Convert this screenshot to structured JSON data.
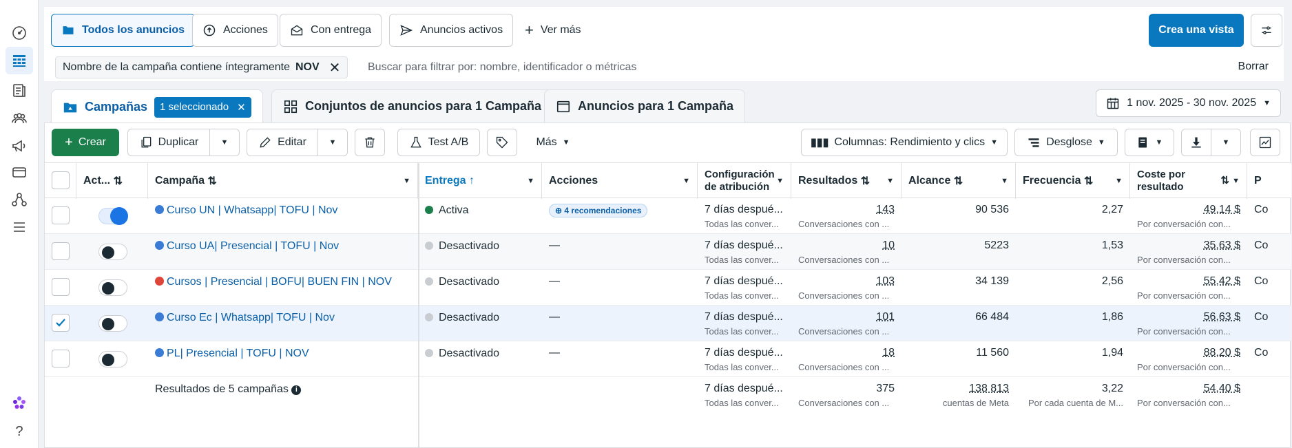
{
  "top_tabs": [
    {
      "label": "Todos los anuncios",
      "icon": "folder-icon"
    },
    {
      "label": "Acciones",
      "icon": "upload-circle-icon"
    },
    {
      "label": "Con entrega",
      "icon": "envelope-icon"
    },
    {
      "label": "Anuncios activos",
      "icon": "send-icon"
    }
  ],
  "more_views": "Ver más",
  "create_view": "Crea una vista",
  "filter": {
    "chip_label": "Nombre de la campaña contiene íntegramente",
    "chip_value": "NOV",
    "placeholder": "Buscar para filtrar por: nombre, identificador o métricas",
    "clear": "Borrar"
  },
  "level_tabs": {
    "campaigns": "Campañas",
    "selected": "1 seleccionado",
    "adsets": "Conjuntos de anuncios para 1 Campaña",
    "ads": "Anuncios para 1 Campaña"
  },
  "date_range": "1 nov. 2025 - 30 nov. 2025",
  "toolbar": {
    "create": "Crear",
    "duplicate": "Duplicar",
    "edit": "Editar",
    "ab_test": "Test A/B",
    "more": "Más",
    "columns": "Columnas: Rendimiento y clics",
    "breakdown": "Desglose"
  },
  "headers": {
    "active": "Act...",
    "campaign": "Campaña",
    "delivery": "Entrega",
    "actions": "Acciones",
    "attribution_1": "Configuración",
    "attribution_2": "de atribución",
    "results": "Resultados",
    "reach": "Alcance",
    "frequency": "Frecuencia",
    "cost_1": "Coste por",
    "cost_2": "resultado",
    "next": "P"
  },
  "rows": [
    {
      "name": "Curso UN | Whatsapp| TOFU | Nov",
      "dot": "#3a7bd5",
      "on": true,
      "checked": false,
      "delivery": "Activa",
      "delivery_color": "#1a7f4b",
      "actions": "4 recomendaciones",
      "attr": "7 días despué...",
      "attr_sub": "Todas las conver...",
      "results": "143",
      "results_sub": "Conversaciones con ...",
      "reach": "90 536",
      "freq": "2,27",
      "cost": "49,14 $",
      "cost_sub": "Por conversación con...",
      "next": "Co"
    },
    {
      "name": "Curso UA| Presencial | TOFU | Nov",
      "dot": "#3a7bd5",
      "on": false,
      "checked": false,
      "delivery": "Desactivado",
      "delivery_color": "#c9ccd1",
      "actions": "—",
      "attr": "7 días despué...",
      "attr_sub": "Todas las conver...",
      "results": "10",
      "results_sub": "Conversaciones con ...",
      "reach": "5223",
      "freq": "1,53",
      "cost": "35,63 $",
      "cost_sub": "Por conversación con...",
      "next": "Co"
    },
    {
      "name": "Cursos | Presencial | BOFU| BUEN FIN | NOV",
      "dot": "#e0453a",
      "on": false,
      "checked": false,
      "delivery": "Desactivado",
      "delivery_color": "#c9ccd1",
      "actions": "—",
      "attr": "7 días despué...",
      "attr_sub": "Todas las conver...",
      "results": "103",
      "results_sub": "Conversaciones con ...",
      "reach": "34 139",
      "freq": "2,56",
      "cost": "55,42 $",
      "cost_sub": "Por conversación con...",
      "next": "Co"
    },
    {
      "name": "Curso Ec | Whatsapp| TOFU | Nov",
      "dot": "#3a7bd5",
      "on": false,
      "checked": true,
      "delivery": "Desactivado",
      "delivery_color": "#c9ccd1",
      "actions": "—",
      "attr": "7 días despué...",
      "attr_sub": "Todas las conver...",
      "results": "101",
      "results_sub": "Conversaciones con ...",
      "reach": "66 484",
      "freq": "1,86",
      "cost": "56,63 $",
      "cost_sub": "Por conversación con...",
      "next": "Co"
    },
    {
      "name": "PL| Presencial | TOFU | NOV",
      "dot": "#3a7bd5",
      "on": false,
      "checked": false,
      "delivery": "Desactivado",
      "delivery_color": "#c9ccd1",
      "actions": "—",
      "attr": "7 días despué...",
      "attr_sub": "Todas las conver...",
      "results": "18",
      "results_sub": "Conversaciones con ...",
      "reach": "11 560",
      "freq": "1,94",
      "cost": "88,20 $",
      "cost_sub": "Por conversación con...",
      "next": "Co"
    }
  ],
  "totals": {
    "label": "Resultados de 5 campañas",
    "attr": "7 días despué...",
    "attr_sub": "Todas las conver...",
    "results": "375",
    "results_sub": "Conversaciones con ...",
    "reach": "138 813",
    "reach_sub": "cuentas de Meta",
    "freq": "3,22",
    "freq_sub": "Por cada cuenta de M...",
    "cost": "54,40 $",
    "cost_sub": "Por conversación con..."
  },
  "help": "?"
}
